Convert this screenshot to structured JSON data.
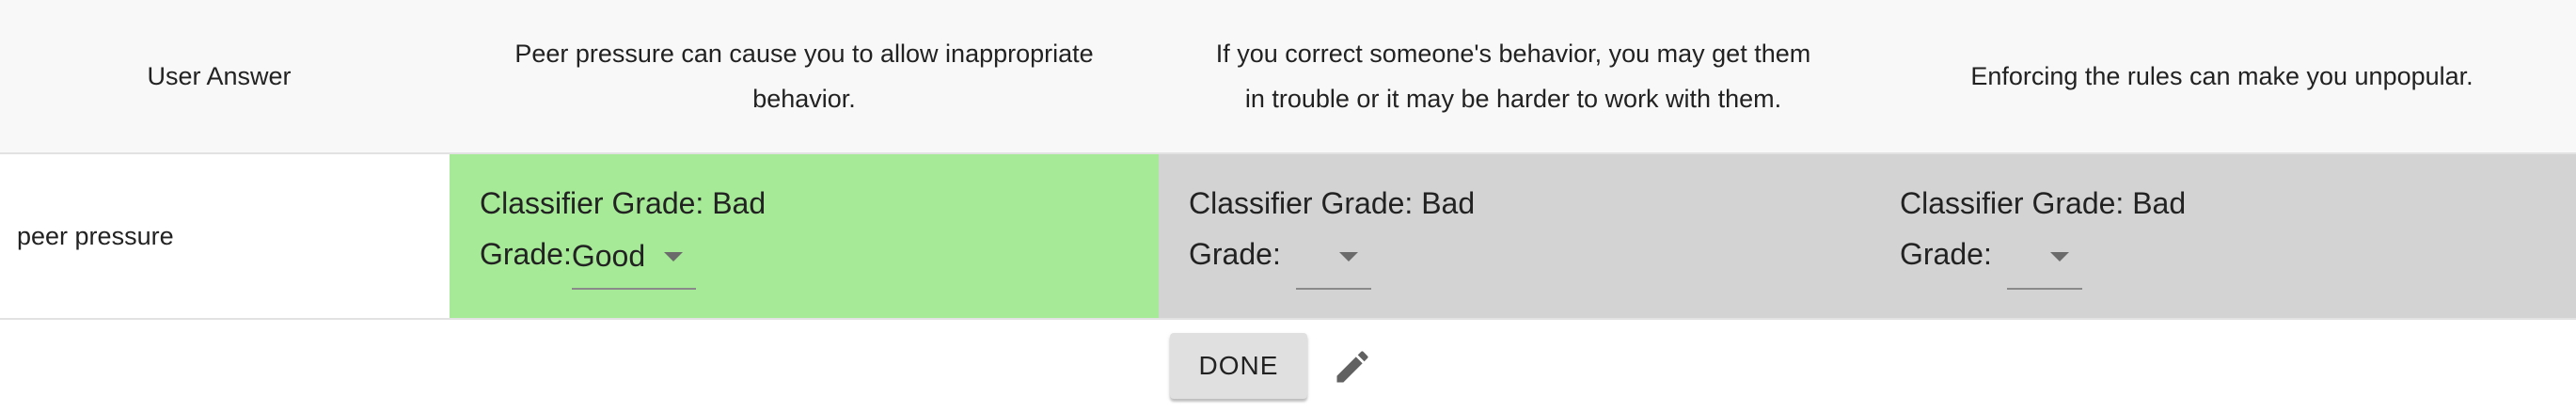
{
  "header": {
    "user_answer": "User Answer",
    "questions": [
      {
        "line1": "Peer pressure can cause you to allow inappropriate",
        "line2": "behavior."
      },
      {
        "line1": "If you correct someone's behavior, you may get them",
        "line2": "in trouble or it may be harder to work with them."
      },
      {
        "line1": "Enforcing the rules can make you unpopular.",
        "line2": ""
      }
    ]
  },
  "row": {
    "user_answer": "peer pressure",
    "cells": [
      {
        "classifier_grade": "Classifier Grade: Bad",
        "grade_label": "Grade:",
        "grade_value": "Good"
      },
      {
        "classifier_grade": "Classifier Grade: Bad",
        "grade_label": "Grade:",
        "grade_value": ""
      },
      {
        "classifier_grade": "Classifier Grade: Bad",
        "grade_label": "Grade:",
        "grade_value": ""
      }
    ]
  },
  "actions": {
    "done_label": "DONE",
    "edit_icon": "pencil-icon"
  },
  "colors": {
    "good_cell": "#a6ea97",
    "neutral_cell": "#d3d3d3",
    "header_bg": "#f8f8f8"
  }
}
